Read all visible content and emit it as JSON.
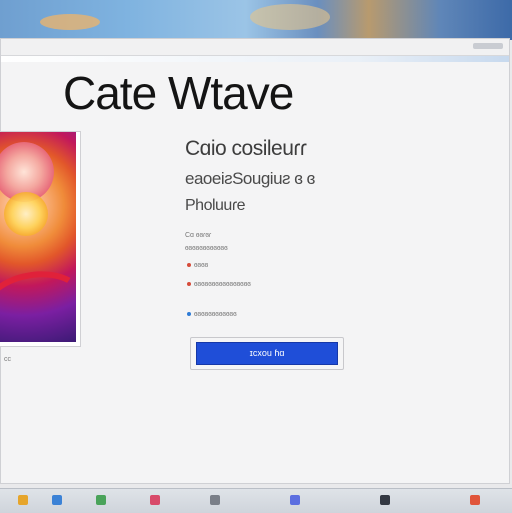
{
  "window": {
    "toolbar_items": [
      "",
      "",
      "",
      "",
      ""
    ]
  },
  "app": {
    "title": "Cate Wtave"
  },
  "thumbnail": {
    "caption": "cc"
  },
  "details": {
    "title": "Cɑio cosileuɾɾ",
    "subtitle": "eaoeiƨSougiuƨ ɞ ɞ",
    "subtitle2": "Pholuuɾe",
    "meta": [
      {
        "text": "Cɑ ɞɞɾɞɾ",
        "dot": ""
      },
      {
        "text": "ɞɞɞɞɞɞɞɞɞɞɞɞ",
        "dot": ""
      },
      {
        "text": "ɞɞɞɞ",
        "dot": "#d64b3a"
      },
      {
        "text": "ɞɞɞɞɞɞɞɞɞɞɞɞɞɞɞɞ",
        "dot": "#d64b3a"
      },
      {
        "text": "ɞɞɞɞɞɞɞɞɞɞɞɞ",
        "dot": "#2e7bd6"
      }
    ]
  },
  "actions": {
    "primary_label": "ɪcxou ɦɑ"
  },
  "colors": {
    "accent": "#1f4ed8",
    "background": "#f4f4f5"
  },
  "taskbar": {
    "icons": [
      "folder-icon",
      "browser-icon",
      "mail-icon",
      "photos-icon",
      "settings-icon",
      "store-icon",
      "terminal-icon",
      "music-icon"
    ]
  }
}
